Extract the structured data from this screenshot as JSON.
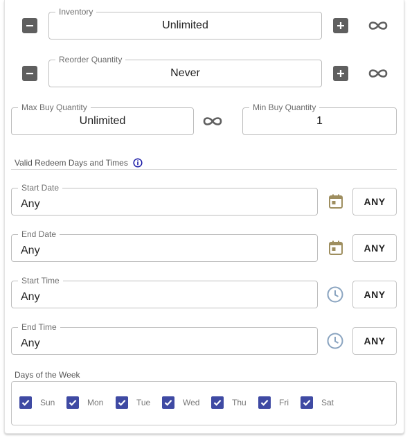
{
  "inventory": {
    "label": "Inventory",
    "value": "Unlimited"
  },
  "reorder": {
    "label": "Reorder Quantity",
    "value": "Never"
  },
  "max_buy": {
    "label": "Max Buy Quantity",
    "value": "Unlimited"
  },
  "min_buy": {
    "label": "Min Buy Quantity",
    "value": "1"
  },
  "redeem_section": {
    "title": "Valid Redeem Days and Times"
  },
  "start_date": {
    "label": "Start Date",
    "value": "Any",
    "button": "ANY"
  },
  "end_date": {
    "label": "End Date",
    "value": "Any",
    "button": "ANY"
  },
  "start_time": {
    "label": "Start Time",
    "value": "Any",
    "button": "ANY"
  },
  "end_time": {
    "label": "End Time",
    "value": "Any",
    "button": "ANY"
  },
  "days_of_week": {
    "title": "Days of the Week",
    "days": [
      {
        "label": "Sun",
        "checked": true
      },
      {
        "label": "Mon",
        "checked": true
      },
      {
        "label": "Tue",
        "checked": true
      },
      {
        "label": "Wed",
        "checked": true
      },
      {
        "label": "Thu",
        "checked": true
      },
      {
        "label": "Fri",
        "checked": true
      },
      {
        "label": "Sat",
        "checked": true
      }
    ]
  },
  "icons": {
    "minus": "minus-icon",
    "plus": "plus-icon",
    "infinity": "infinity-icon",
    "calendar": "calendar-icon",
    "clock": "clock-icon",
    "info": "info-icon",
    "check": "check-icon"
  },
  "colors": {
    "accent_checkbox": "#3f4aa3",
    "calendar_icon": "#9e8e5f",
    "clock_icon": "#8aa4c0",
    "info_icon": "#1a1aa6",
    "button_gray": "#5f5f5f"
  }
}
